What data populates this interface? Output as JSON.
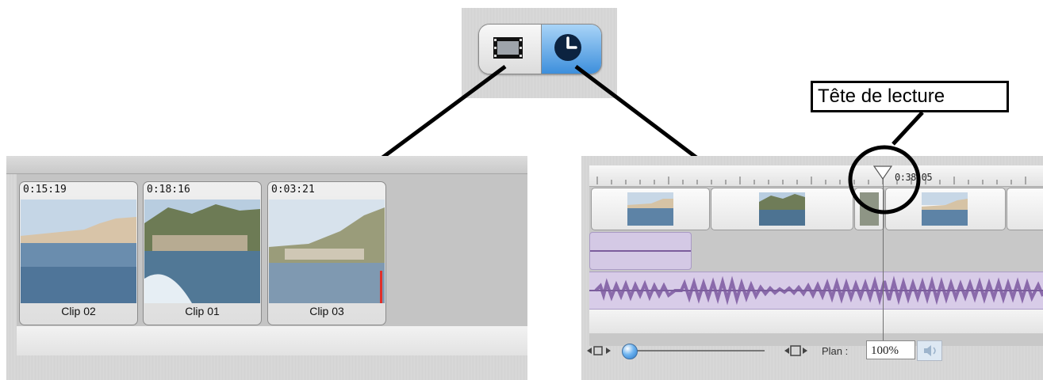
{
  "toggle": {
    "clip_view_icon": "film-strip-icon",
    "timeline_view_icon": "clock-icon",
    "accent": "#3d8fdc"
  },
  "clip_viewer": {
    "clips": [
      {
        "duration": "0:15:19",
        "name": "Clip 02"
      },
      {
        "duration": "0:18:16",
        "name": "Clip 01"
      },
      {
        "duration": "0:03:21",
        "name": "Clip 03"
      }
    ]
  },
  "timeline": {
    "playhead_time": "0:38:05",
    "zoom_label": "Plan :",
    "zoom_value": "100%",
    "audio_color": "#8a6aab"
  },
  "annotation": {
    "playhead_label": "Tête de lecture"
  }
}
